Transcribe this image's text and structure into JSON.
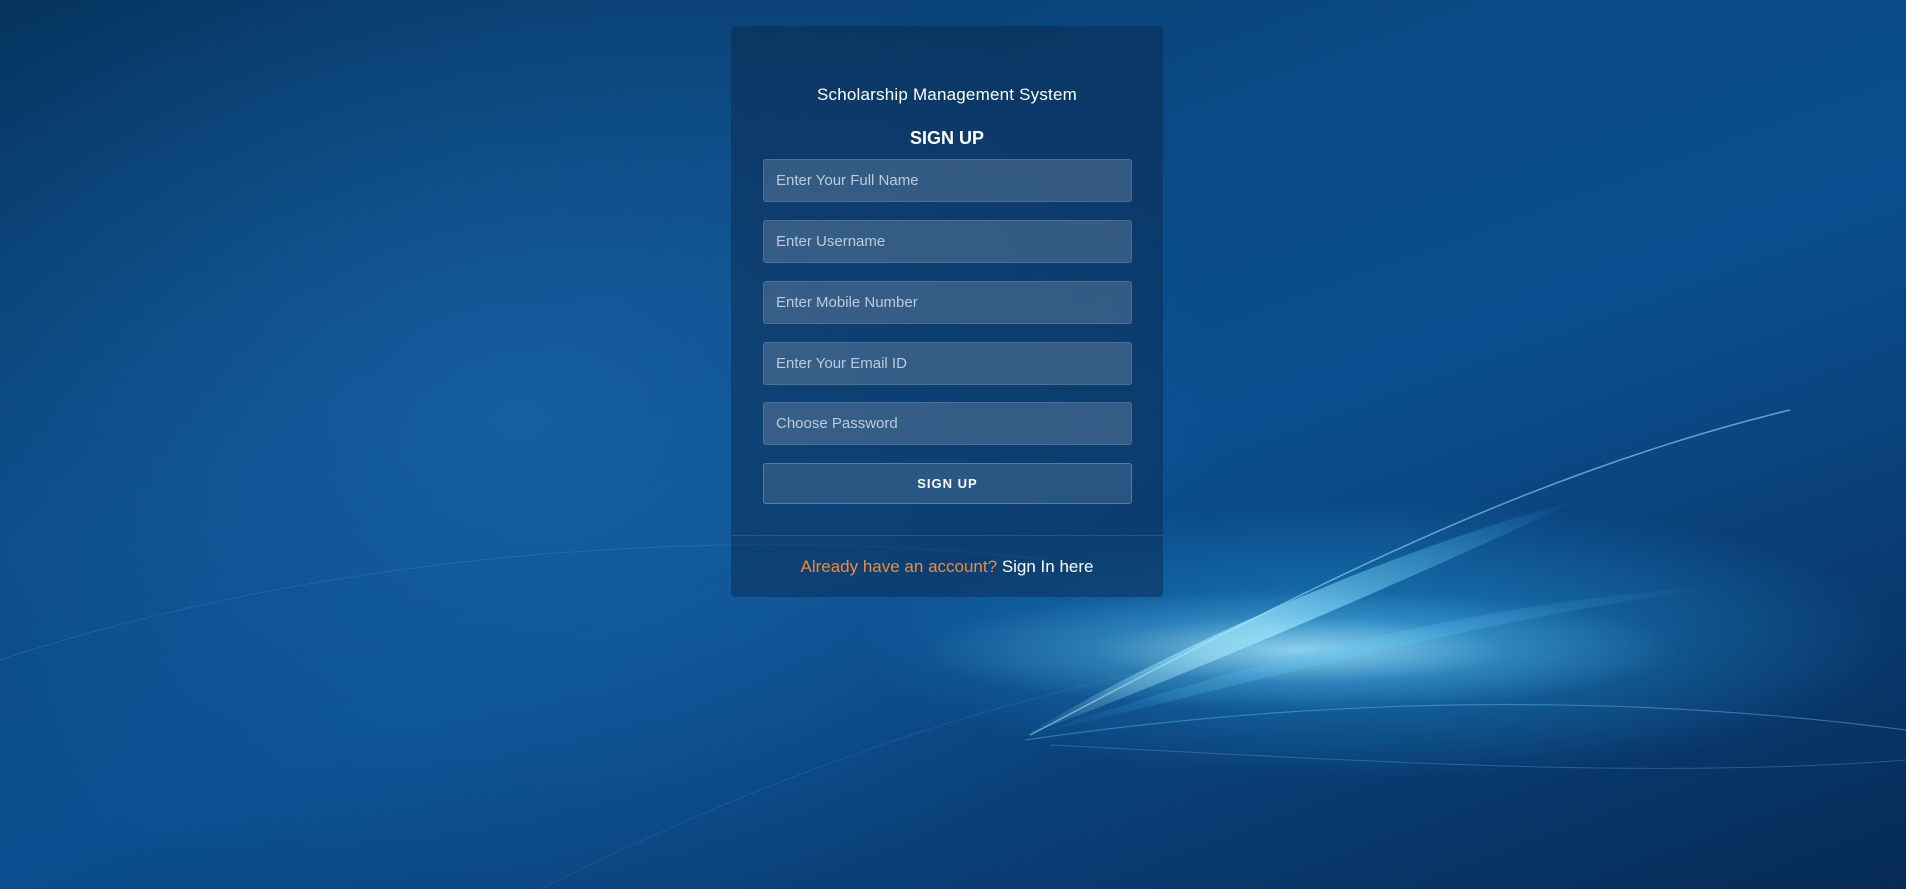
{
  "app": {
    "title": "Scholarship Management System"
  },
  "form": {
    "heading": "SIGN UP",
    "fields": {
      "full_name": {
        "placeholder": "Enter Your Full Name",
        "value": ""
      },
      "username": {
        "placeholder": "Enter Username",
        "value": ""
      },
      "mobile": {
        "placeholder": "Enter Mobile Number",
        "value": ""
      },
      "email": {
        "placeholder": "Enter Your Email ID",
        "value": ""
      },
      "password": {
        "placeholder": "Choose Password",
        "value": ""
      }
    },
    "submit_label": "SIGN UP"
  },
  "footer": {
    "prompt": "Already have an account?",
    "link_label": "Sign In here"
  },
  "colors": {
    "accent_orange": "#f28a30",
    "text_white": "#ffffff",
    "background_blue": "#0b4a86"
  }
}
